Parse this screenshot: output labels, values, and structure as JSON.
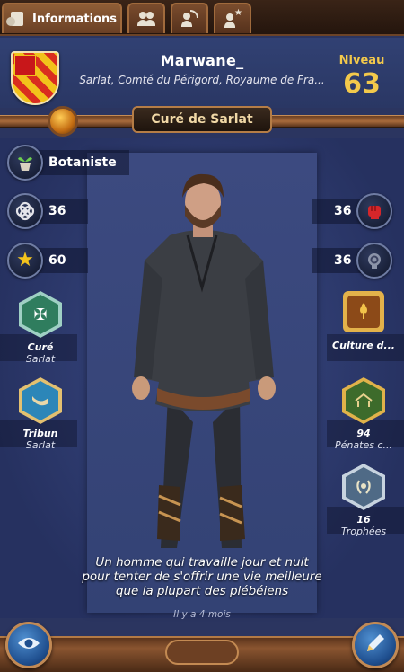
{
  "tabs": [
    {
      "label": "Informations",
      "icon": "profile-card-icon"
    },
    {
      "label": "",
      "icon": "people-icon"
    },
    {
      "label": "",
      "icon": "person-signal-icon"
    },
    {
      "label": "",
      "icon": "person-star-icon"
    }
  ],
  "header": {
    "player_name": "Marwane_",
    "location": "Sarlat, Comté du Périgord, Royaume de Fra...",
    "level_label": "Niveau",
    "level_value": "63",
    "coat_of_arms": "coat-of-arms-icon"
  },
  "title_plaque": "Curé de Sarlat",
  "skill": {
    "label": "Botaniste",
    "icon": "plant-pot-icon"
  },
  "stats_left": [
    {
      "value": "36",
      "icon": "knot-icon"
    },
    {
      "value": "60",
      "icon": "star-icon"
    }
  ],
  "stats_right": [
    {
      "value": "36",
      "icon": "fist-icon"
    },
    {
      "value": "36",
      "icon": "brain-gear-icon"
    }
  ],
  "badges_left": [
    {
      "title": "Curé",
      "subtitle": "Sarlat",
      "icon": "cross-icon"
    },
    {
      "title": "Tribun",
      "subtitle": "Sarlat",
      "icon": "horn-icon"
    }
  ],
  "badges_right": [
    {
      "title": "Culture d...",
      "subtitle": "",
      "icon": "wheat-icon"
    },
    {
      "title": "94",
      "subtitle": "Pénates c...",
      "icon": "house-icon"
    },
    {
      "title": "16",
      "subtitle": "Trophées",
      "icon": "laurel-icon"
    }
  ],
  "description": "Un homme qui travaille jour et nuit pour tenter de s'offrir une vie meilleure que la plupart des plébéiens",
  "timestamp": "Il y a 4 mois",
  "buttons": {
    "view": "eye-icon",
    "edit": "pencil-icon"
  },
  "colors": {
    "gold": "#f3c94b",
    "panel": "#334274",
    "wood": "#8a5530"
  }
}
